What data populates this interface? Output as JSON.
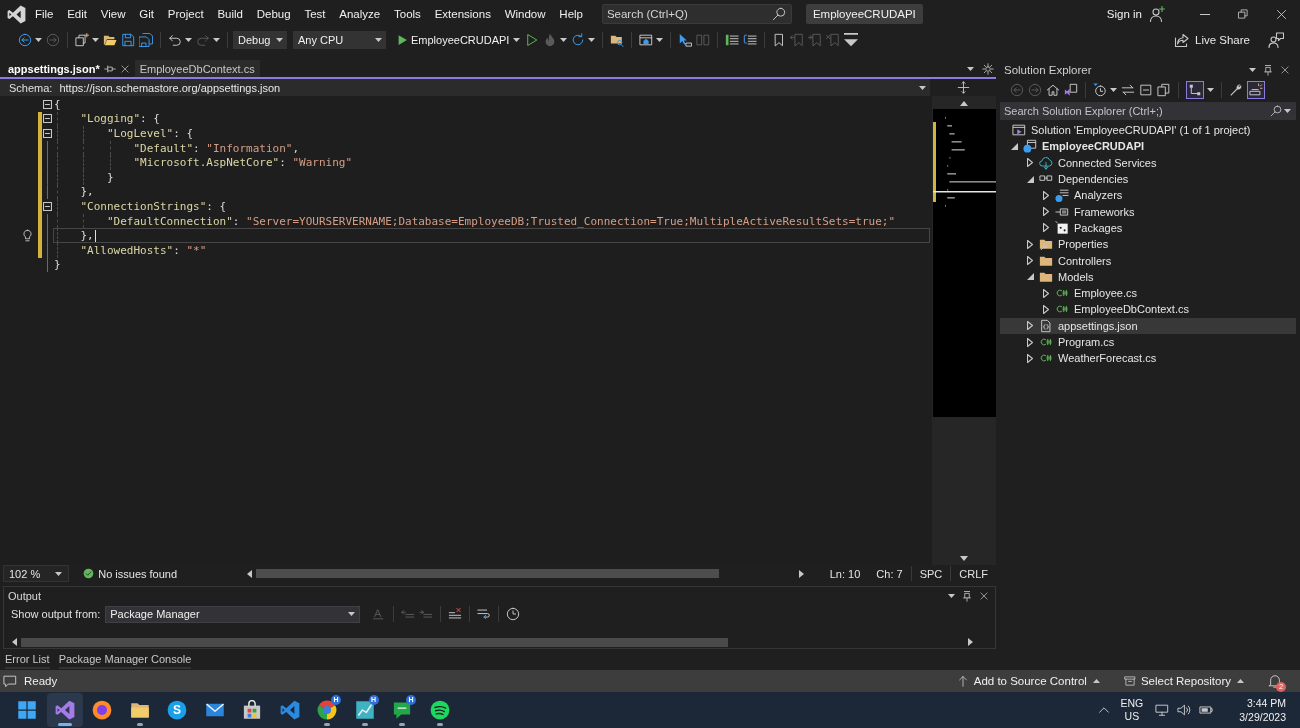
{
  "titlebar": {
    "menu": [
      "File",
      "Edit",
      "View",
      "Git",
      "Project",
      "Build",
      "Debug",
      "Test",
      "Analyze",
      "Tools",
      "Extensions",
      "Window",
      "Help"
    ],
    "search": {
      "placeholder": "Search (Ctrl+Q)"
    },
    "solution_name": "EmployeeCRUDAPI",
    "sign_in": "Sign in"
  },
  "toolbar": {
    "groups": [
      [
        {
          "kind": "back",
          "disabled": false,
          "menu": true
        },
        {
          "kind": "forward",
          "disabled": true,
          "menu": false
        }
      ],
      [
        {
          "kind": "new-item",
          "disabled": false,
          "menu": true
        },
        {
          "kind": "open",
          "disabled": false,
          "menu": false
        },
        {
          "kind": "save",
          "disabled": false,
          "menu": false
        },
        {
          "kind": "save-all",
          "disabled": false,
          "menu": false
        }
      ],
      [
        {
          "kind": "undo",
          "disabled": false,
          "menu": true
        },
        {
          "kind": "redo",
          "disabled": true,
          "menu": true
        }
      ],
      [
        {
          "kind": "select",
          "value": "Debug",
          "disabled": false,
          "menu": true
        },
        {
          "kind": "select",
          "value": "Any CPU",
          "disabled": false,
          "menu": true
        },
        {
          "kind": "start",
          "label": "EmployeeCRUDAPI",
          "disabled": false,
          "menu": true
        },
        {
          "kind": "run",
          "disabled": false,
          "menu": false
        },
        {
          "kind": "hot-reload",
          "disabled": true,
          "menu": true
        },
        {
          "kind": "restart",
          "disabled": false,
          "menu": true
        }
      ],
      [
        {
          "kind": "folder-search",
          "disabled": false,
          "menu": false
        }
      ],
      [
        {
          "kind": "browser",
          "disabled": false,
          "menu": true
        }
      ],
      [
        {
          "kind": "step",
          "disabled": false,
          "menu": false
        },
        {
          "kind": "columns",
          "disabled": true,
          "menu": false
        }
      ],
      [
        {
          "kind": "comment",
          "disabled": false,
          "menu": false
        },
        {
          "kind": "uncomment",
          "disabled": false,
          "menu": false
        }
      ],
      [
        {
          "kind": "bookmark",
          "disabled": false,
          "menu": false
        },
        {
          "kind": "bookmark-prev",
          "disabled": true,
          "menu": false
        },
        {
          "kind": "bookmark-next",
          "disabled": true,
          "menu": false
        },
        {
          "kind": "bookmark-clear",
          "disabled": true,
          "menu": false
        },
        {
          "kind": "overflow",
          "disabled": false,
          "menu": false
        }
      ]
    ],
    "live_share": "Live Share"
  },
  "editor": {
    "tabs": [
      {
        "label": "appsettings.json*",
        "selected": true
      },
      {
        "label": "EmployeeDbContext.cs",
        "selected": false
      }
    ],
    "schema": {
      "label": "Schema:",
      "value": "https://json.schemastore.org/appsettings.json"
    },
    "lines": [
      {
        "tokens": [
          {
            "kind": "punct",
            "text": "{"
          }
        ],
        "fold": true,
        "modified": false,
        "current": false
      },
      {
        "tokens": [
          {
            "kind": "key",
            "text": "    \"Logging\""
          },
          {
            "kind": "punct",
            "text": ": {"
          }
        ],
        "fold": true,
        "modified": true,
        "current": false
      },
      {
        "tokens": [
          {
            "kind": "key",
            "text": "        \"LogLevel\""
          },
          {
            "kind": "punct",
            "text": ": {"
          }
        ],
        "fold": true,
        "modified": true,
        "current": false
      },
      {
        "tokens": [
          {
            "kind": "key",
            "text": "            \"Default\""
          },
          {
            "kind": "punct",
            "text": ": "
          },
          {
            "kind": "string",
            "text": "\"Information\""
          },
          {
            "kind": "punct",
            "text": ","
          }
        ],
        "fold": false,
        "modified": true,
        "current": false
      },
      {
        "tokens": [
          {
            "kind": "key",
            "text": "            \"Microsoft.AspNetCore\""
          },
          {
            "kind": "punct",
            "text": ": "
          },
          {
            "kind": "string",
            "text": "\"Warning\""
          }
        ],
        "fold": false,
        "modified": true,
        "current": false
      },
      {
        "tokens": [
          {
            "kind": "punct",
            "text": "        }"
          }
        ],
        "fold": false,
        "modified": true,
        "current": false
      },
      {
        "tokens": [
          {
            "kind": "punct",
            "text": "    },"
          }
        ],
        "fold": false,
        "modified": true,
        "current": false
      },
      {
        "tokens": [
          {
            "kind": "key",
            "text": "    \"ConnectionStrings\""
          },
          {
            "kind": "punct",
            "text": ": {"
          }
        ],
        "fold": true,
        "modified": true,
        "current": false
      },
      {
        "tokens": [
          {
            "kind": "key",
            "text": "        \"DefaultConnection\""
          },
          {
            "kind": "punct",
            "text": ": "
          },
          {
            "kind": "string",
            "text": "\"Server=YOURSERVERNAME;Database=EmployeeDB;Trusted_Connection=True;MultipleActiveResultSets=true;\""
          }
        ],
        "fold": false,
        "modified": true,
        "current": false
      },
      {
        "tokens": [
          {
            "kind": "punct",
            "text": "    },"
          }
        ],
        "fold": false,
        "modified": true,
        "current": true
      },
      {
        "tokens": [
          {
            "kind": "key",
            "text": "    \"AllowedHosts\""
          },
          {
            "kind": "punct",
            "text": ": "
          },
          {
            "kind": "string",
            "text": "\"*\""
          }
        ],
        "fold": false,
        "modified": true,
        "current": false
      },
      {
        "tokens": [
          {
            "kind": "punct",
            "text": "}"
          }
        ],
        "fold": false,
        "modified": false,
        "current": false
      }
    ],
    "status": {
      "zoom": "102 %",
      "issues": "No issues found",
      "line": "Ln: 10",
      "column": "Ch: 7",
      "indentation": "SPC",
      "line_ending": "CRLF"
    }
  },
  "output": {
    "title": "Output",
    "source_label": "Show output from:",
    "source": "Package Manager",
    "toolbar": [
      [
        {
          "kind": "find-message",
          "disabled": true
        }
      ],
      [
        {
          "kind": "prev-message",
          "disabled": true
        },
        {
          "kind": "next-message",
          "disabled": true
        }
      ],
      [
        {
          "kind": "clear-all",
          "disabled": false
        }
      ],
      [
        {
          "kind": "word-wrap",
          "disabled": false
        }
      ],
      [
        {
          "kind": "timestamps",
          "disabled": false
        }
      ]
    ]
  },
  "bottom_tabs": [
    "Error List",
    "Package Manager Console"
  ],
  "solution_explorer": {
    "title": "Solution Explorer",
    "toolbar": [
      [
        {
          "kind": "back",
          "disabled": true,
          "on": false,
          "menu": false
        },
        {
          "kind": "forward",
          "disabled": true,
          "on": false,
          "menu": false
        },
        {
          "kind": "home",
          "disabled": false,
          "on": false,
          "menu": false
        },
        {
          "kind": "switch-views",
          "disabled": false,
          "on": false,
          "menu": false
        }
      ],
      [
        {
          "kind": "pending-changes",
          "disabled": false,
          "on": false,
          "menu": true
        },
        {
          "kind": "sync",
          "disabled": false,
          "on": false,
          "menu": false
        },
        {
          "kind": "collapse-all",
          "disabled": false,
          "on": false,
          "menu": false
        },
        {
          "kind": "show-all-files",
          "disabled": false,
          "on": false,
          "menu": false
        }
      ],
      [
        {
          "kind": "tree-view",
          "disabled": false,
          "on": true,
          "menu": true
        }
      ],
      [
        {
          "kind": "properties",
          "disabled": false,
          "on": false,
          "menu": false
        },
        {
          "kind": "preview",
          "disabled": false,
          "on": true,
          "menu": false
        }
      ]
    ],
    "search": {
      "placeholder": "Search Solution Explorer (Ctrl+;)"
    },
    "tree": [
      {
        "label": "Solution 'EmployeeCRUDAPI' (1 of 1 project)",
        "kind": "solution",
        "selected": false,
        "children": [
          {
            "label": "EmployeeCRUDAPI",
            "kind": "project",
            "expanded": true,
            "selected": false,
            "children": [
              {
                "label": "Connected Services",
                "kind": "service",
                "expanded": false,
                "selected": false
              },
              {
                "label": "Dependencies",
                "kind": "dependencies",
                "expanded": true,
                "selected": false,
                "children": [
                  {
                    "label": "Analyzers",
                    "kind": "analyzers",
                    "expanded": false,
                    "selected": false
                  },
                  {
                    "label": "Frameworks",
                    "kind": "frameworks",
                    "expanded": false,
                    "selected": false
                  },
                  {
                    "label": "Packages",
                    "kind": "packages",
                    "expanded": false,
                    "selected": false
                  }
                ]
              },
              {
                "label": "Properties",
                "kind": "properties",
                "expanded": false,
                "selected": false
              },
              {
                "label": "Controllers",
                "kind": "folder",
                "expanded": false,
                "selected": false
              },
              {
                "label": "Models",
                "kind": "folder",
                "expanded": true,
                "selected": false,
                "children": [
                  {
                    "label": "Employee.cs",
                    "kind": "csharp",
                    "expanded": false,
                    "selected": false
                  },
                  {
                    "label": "EmployeeDbContext.cs",
                    "kind": "csharp",
                    "expanded": false,
                    "selected": false
                  }
                ]
              },
              {
                "label": "appsettings.json",
                "kind": "json",
                "expanded": false,
                "selected": true
              },
              {
                "label": "Program.cs",
                "kind": "csharp",
                "expanded": false,
                "selected": false
              },
              {
                "label": "WeatherForecast.cs",
                "kind": "csharp",
                "expanded": false,
                "selected": false
              }
            ]
          }
        ]
      }
    ]
  },
  "status_bar": {
    "message": "Ready",
    "source_control": "Add to Source Control",
    "repository": "Select Repository",
    "notifications": "2"
  },
  "taskbar": {
    "apps": [
      {
        "kind": "start",
        "selected": false,
        "running": false
      },
      {
        "kind": "ribbon",
        "selected": true,
        "running": true
      },
      {
        "kind": "globe",
        "selected": false,
        "running": false
      },
      {
        "kind": "folder",
        "selected": false,
        "running": true
      },
      {
        "kind": "letter",
        "glyph": "S",
        "selected": false,
        "running": false
      },
      {
        "kind": "mail",
        "selected": false,
        "running": false
      },
      {
        "kind": "store",
        "selected": false,
        "running": false
      },
      {
        "kind": "ribbon-blue",
        "selected": false,
        "running": false
      },
      {
        "kind": "wheel",
        "badge": "H",
        "selected": false,
        "running": true
      },
      {
        "kind": "chart",
        "badge": "H",
        "selected": false,
        "running": true
      },
      {
        "kind": "chat",
        "badge": "H",
        "selected": false,
        "running": true
      },
      {
        "kind": "waves",
        "selected": false,
        "running": true
      }
    ],
    "language": "ENG",
    "region": "US",
    "time": "3:44 PM",
    "date": "3/29/2023"
  }
}
